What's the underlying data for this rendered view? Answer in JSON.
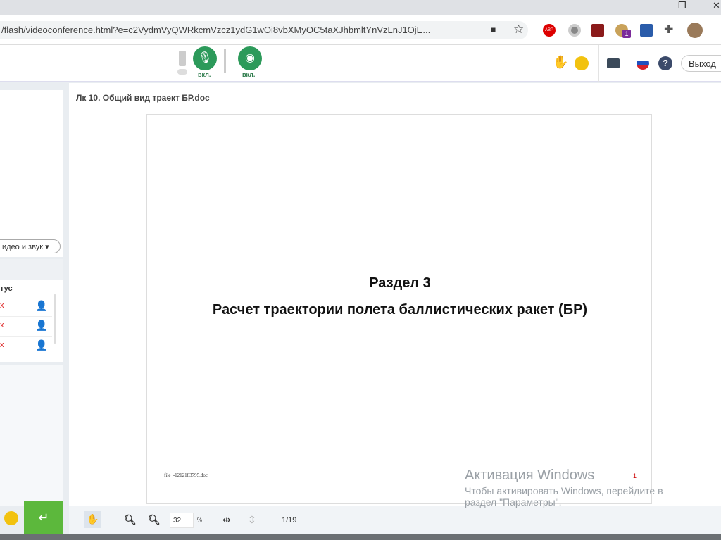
{
  "browser": {
    "url": "/flash/videoconference.html?e=c2VydmVyQWRkcmVzcz1ydG1wOi8vbXMyOC5taXJhbmltYnVzLnJ1OjE...",
    "window_controls": [
      "–",
      "❐",
      "✕"
    ],
    "ext_badge": "1",
    "abp": "ABP"
  },
  "toolbar": {
    "mic_label": "вкл.",
    "cam_label": "вкл.",
    "exit_label": "Выход"
  },
  "sidebar": {
    "dropdown_label": "идео и звук",
    "status_header": "тус",
    "participants": [
      {
        "status": "x"
      },
      {
        "status": "x"
      },
      {
        "status": "x"
      }
    ]
  },
  "document": {
    "title": "Лк 10. Общий вид траект БР.doc",
    "heading": "Раздел 3",
    "subheading": "Расчет траектории полета баллистических ракет (БР)",
    "footer_file": "file_-1212183795.doc",
    "page_mark": "1"
  },
  "viewer": {
    "zoom_value": "32",
    "zoom_unit": "%",
    "page_indicator": "1/19"
  },
  "watermark": {
    "title": "Активация Windows",
    "line1": "Чтобы активировать Windows, перейдите в",
    "line2": "раздел \"Параметры\"."
  }
}
